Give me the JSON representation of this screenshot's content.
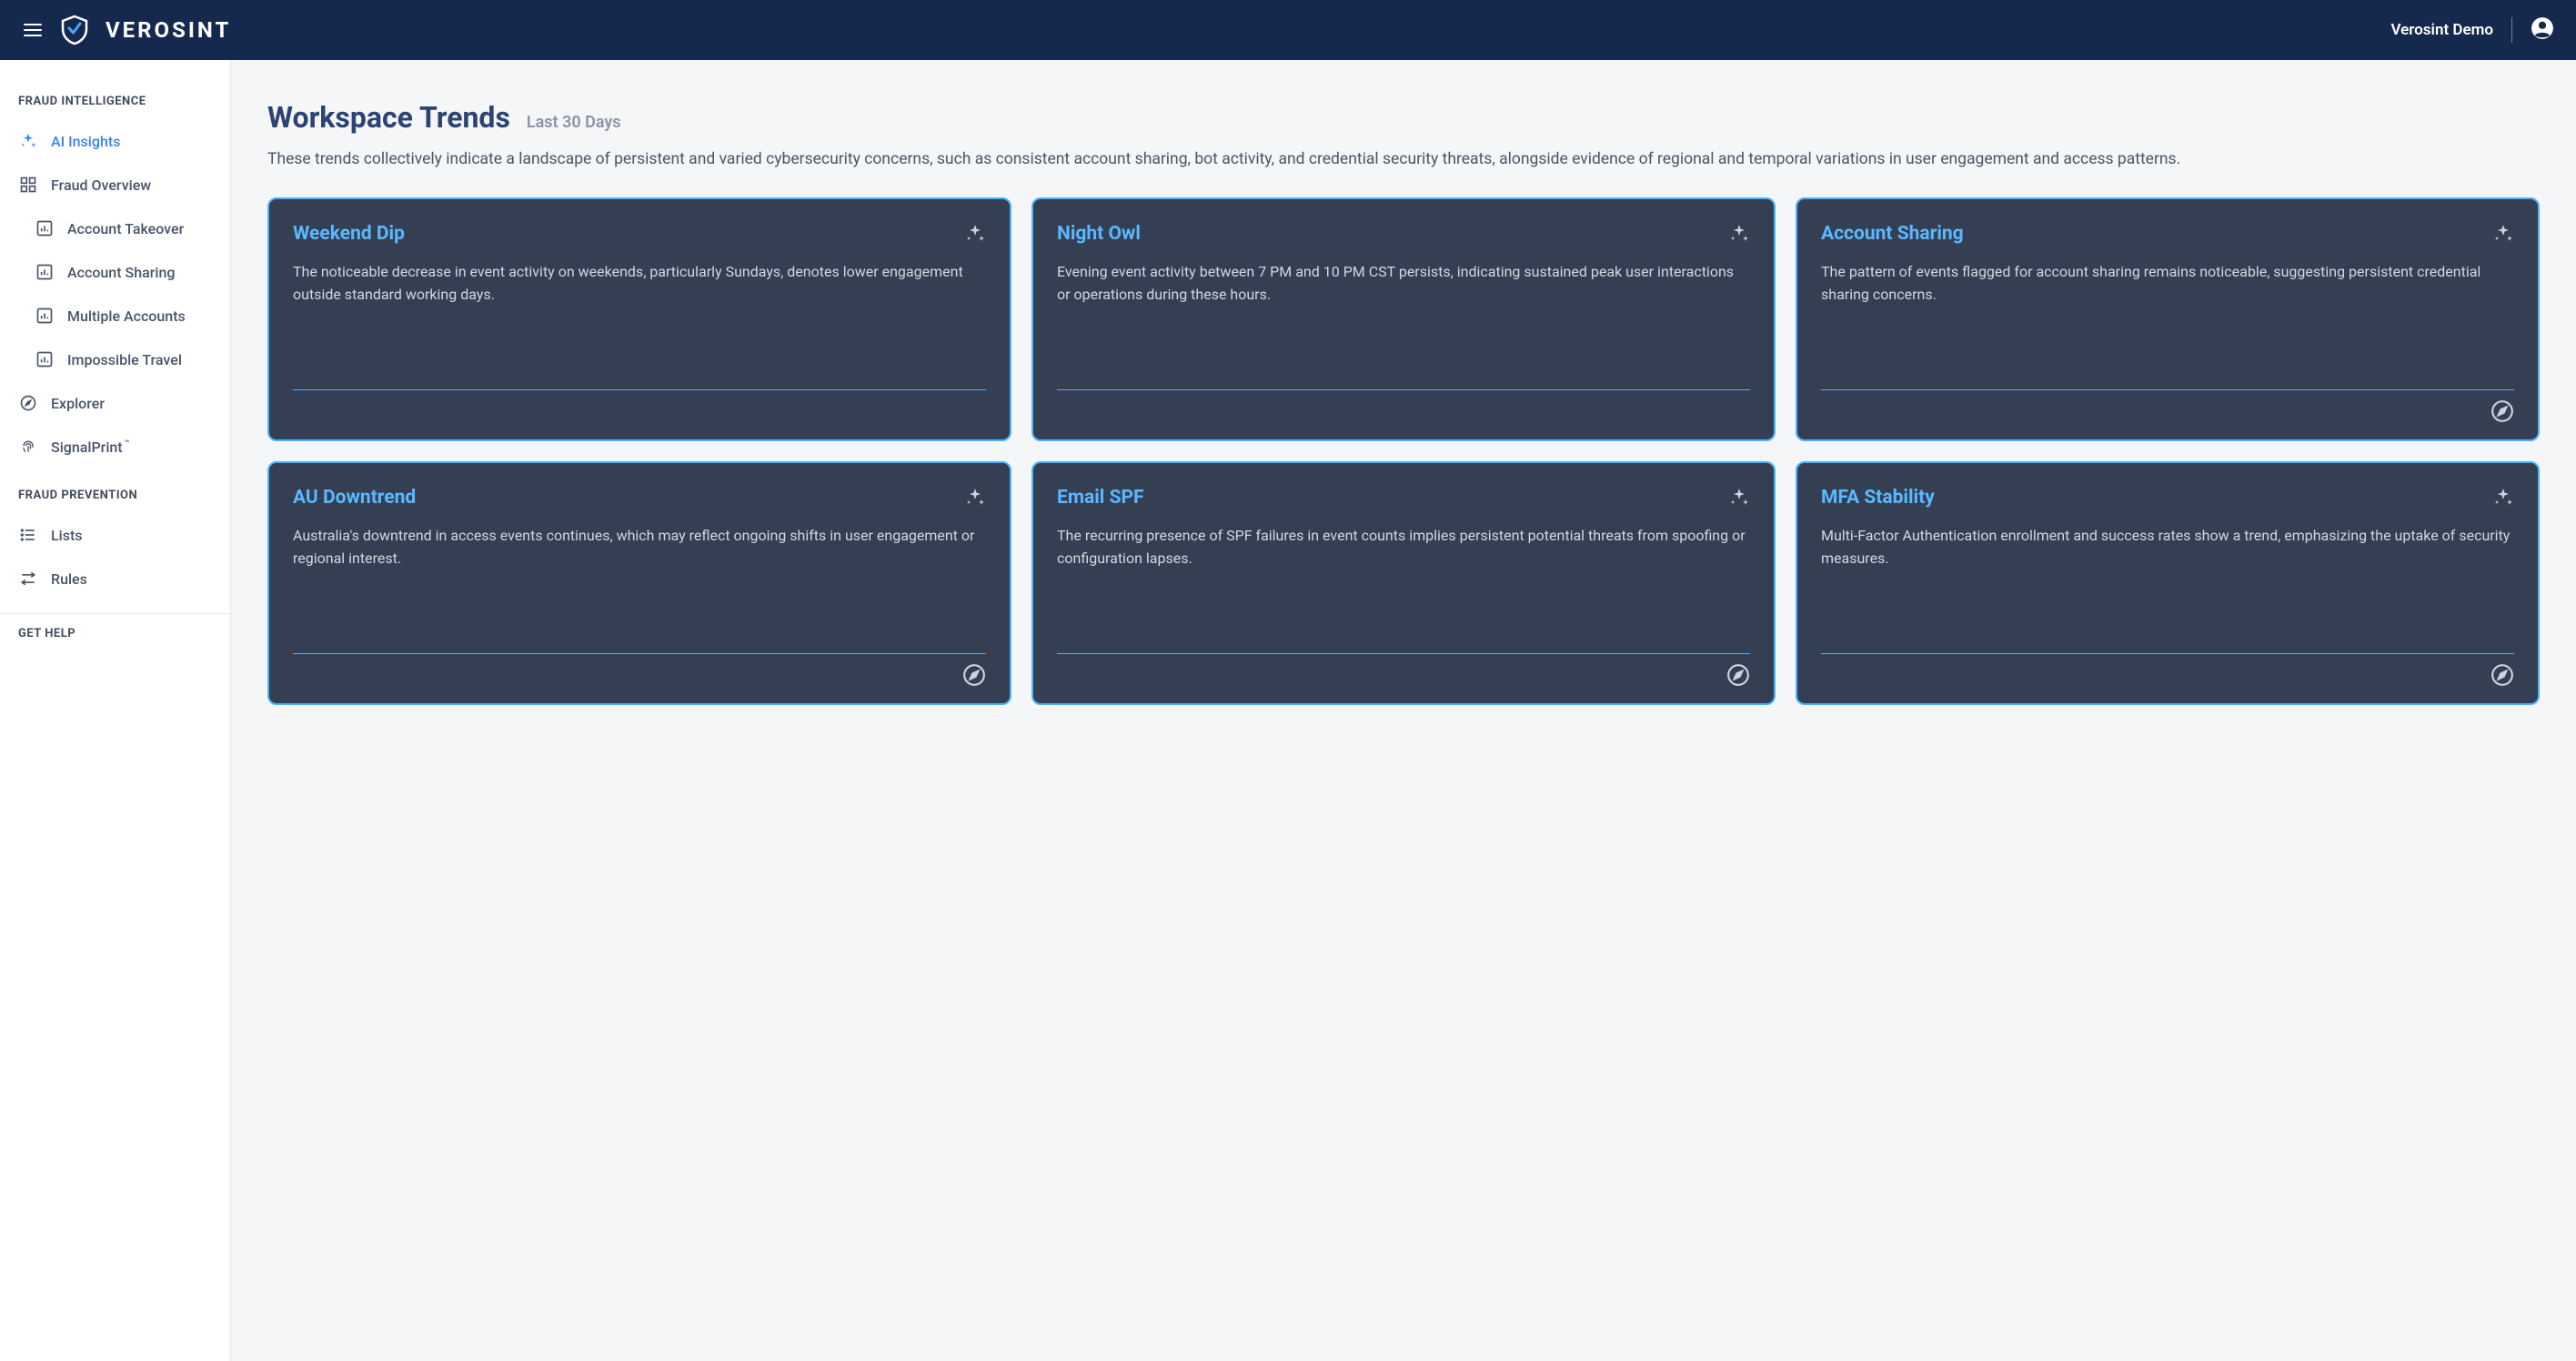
{
  "header": {
    "brand": "VEROSINT",
    "workspace": "Verosint Demo"
  },
  "sidebar": {
    "sections": {
      "intelligence_label": "FRAUD INTELLIGENCE",
      "prevention_label": "FRAUD PREVENTION",
      "help_label": "GET HELP"
    },
    "items": {
      "ai_insights": "AI Insights",
      "fraud_overview": "Fraud Overview",
      "account_takeover": "Account Takeover",
      "account_sharing": "Account Sharing",
      "multiple_accounts": "Multiple Accounts",
      "impossible_travel": "Impossible Travel",
      "explorer": "Explorer",
      "signalprint": "SignalPrint",
      "lists": "Lists",
      "rules": "Rules"
    }
  },
  "main": {
    "title": "Workspace Trends",
    "subtitle": "Last 30 Days",
    "description": "These trends collectively indicate a landscape of persistent and varied cybersecurity concerns, such as consistent account sharing, bot activity, and credential security threats, alongside evidence of regional and temporal variations in user engagement and access patterns."
  },
  "cards": [
    {
      "title": "Weekend Dip",
      "desc": "The noticeable decrease in event activity on weekends, particularly Sundays, denotes lower engagement outside standard working days.",
      "has_compass": false
    },
    {
      "title": "Night Owl",
      "desc": "Evening event activity between 7 PM and 10 PM CST persists, indicating sustained peak user interactions or operations during these hours.",
      "has_compass": false
    },
    {
      "title": "Account Sharing",
      "desc": "The pattern of events flagged for account sharing remains noticeable, suggesting persistent credential sharing concerns.",
      "has_compass": true
    },
    {
      "title": "AU Downtrend",
      "desc": "Australia's downtrend in access events continues, which may reflect ongoing shifts in user engagement or regional interest.",
      "has_compass": true
    },
    {
      "title": "Email SPF",
      "desc": "The recurring presence of SPF failures in event counts implies persistent potential threats from spoofing or configuration lapses.",
      "has_compass": true
    },
    {
      "title": "MFA Stability",
      "desc": "Multi-Factor Authentication enrollment and success rates show a trend, emphasizing the uptake of security measures.",
      "has_compass": true
    }
  ]
}
